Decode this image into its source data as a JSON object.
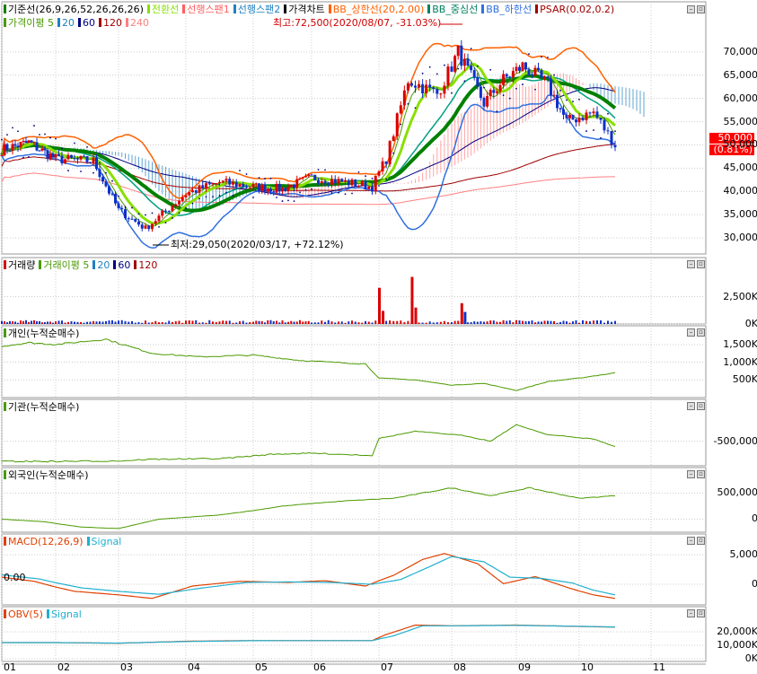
{
  "colors": {
    "bg": "#ffffff",
    "grid": "#cccccc",
    "up": "#d90000",
    "down": "#1030c8",
    "kijun": "#008000",
    "tenkan": "#88e000",
    "span1": "#ff8080",
    "span2": "#2080c0",
    "bb_upper": "#ff6000",
    "bb_mid": "#00a080",
    "bb_lower": "#3070e0",
    "ma20": "#2080c0",
    "ma60": "#000080",
    "ma120": "#a00000",
    "ma240": "#ff8080",
    "flow": "#4a9a00",
    "macd": "#e04000",
    "signal": "#20b0d0",
    "obv": "#e04000"
  },
  "legend_price_1": [
    {
      "text": "기준선(26,9,26,52,26,26,26)",
      "color": "#000000",
      "marker": "#008000"
    },
    {
      "text": "전환선",
      "color": "#88e000",
      "marker": "#88e000"
    },
    {
      "text": "선행스팬1",
      "color": "#ff6060",
      "marker": "#ff6060"
    },
    {
      "text": "선행스팬2",
      "color": "#2080c0",
      "marker": "#2080c0"
    },
    {
      "text": "가격차트",
      "color": "#000000",
      "marker": "#000000"
    },
    {
      "text": "BB_상한선(20,2.00)",
      "color": "#ff6000",
      "marker": "#ff6000"
    },
    {
      "text": "BB_중심선",
      "color": "#008060",
      "marker": "#008060"
    },
    {
      "text": "BB_하한선",
      "color": "#3070e0",
      "marker": "#3070e0"
    },
    {
      "text": "PSAR(0.02,0.2)",
      "color": "#a00000",
      "marker": "#a00000"
    }
  ],
  "legend_price_2": [
    {
      "text": "가격이평 5",
      "color": "#4a9a00",
      "marker": "#4a9a00"
    },
    {
      "text": "20",
      "color": "#2080c0",
      "marker": "#2080c0"
    },
    {
      "text": "60",
      "color": "#000080",
      "marker": "#000080"
    },
    {
      "text": "120",
      "color": "#a00000",
      "marker": "#a00000"
    },
    {
      "text": "240",
      "color": "#ff8080",
      "marker": "#ff8080"
    }
  ],
  "annotations": {
    "high": "최고:72,500(2020/08/07, -31.03%)",
    "low": "최저:29,050(2020/03/17, +72.12%)",
    "current_price": "50,000",
    "current_change": "(0.81%)"
  },
  "x_axis": {
    "labels": [
      "01",
      "02",
      "03",
      "04",
      "05",
      "06",
      "07",
      "08",
      "09",
      "10",
      "11"
    ]
  },
  "panels": {
    "volume": {
      "legend": [
        {
          "text": "거래량",
          "color": "#000000",
          "marker": "#d90000"
        },
        {
          "text": "거래이평 5",
          "color": "#4a9a00",
          "marker": "#4a9a00"
        },
        {
          "text": "20",
          "color": "#2080c0",
          "marker": "#2080c0"
        },
        {
          "text": "60",
          "color": "#000080",
          "marker": "#000080"
        },
        {
          "text": "120",
          "color": "#a00000",
          "marker": "#a00000"
        }
      ]
    },
    "individual": {
      "legend": [
        {
          "text": "개인(누적순매수)",
          "color": "#000000",
          "marker": "#4a9a00"
        }
      ]
    },
    "institution": {
      "legend": [
        {
          "text": "기관(누적순매수)",
          "color": "#000000",
          "marker": "#4a9a00"
        }
      ]
    },
    "foreign": {
      "legend": [
        {
          "text": "외국인(누적순매수)",
          "color": "#000000",
          "marker": "#4a9a00"
        }
      ]
    },
    "macd": {
      "legend": [
        {
          "text": "MACD(12,26,9)",
          "color": "#e04000",
          "marker": "#e04000"
        },
        {
          "text": "Signal",
          "color": "#20b0d0",
          "marker": "#20b0d0"
        }
      ],
      "zero_label": "0.00"
    },
    "obv": {
      "legend": [
        {
          "text": "OBV(5)",
          "color": "#e04000",
          "marker": "#e04000"
        },
        {
          "text": "Signal",
          "color": "#20b0d0",
          "marker": "#20b0d0"
        }
      ]
    }
  },
  "chart_data": [
    {
      "type": "candlestick",
      "title": "가격차트",
      "months": [
        "01",
        "02",
        "03",
        "04",
        "05",
        "06",
        "07",
        "08",
        "09",
        "10"
      ],
      "close_trend": [
        {
          "m": 1.0,
          "v": 49000
        },
        {
          "m": 1.5,
          "v": 50500
        },
        {
          "m": 2.0,
          "v": 47000
        },
        {
          "m": 2.6,
          "v": 46500
        },
        {
          "m": 3.0,
          "v": 36000
        },
        {
          "m": 3.4,
          "v": 32000
        },
        {
          "m": 3.6,
          "v": 34500
        },
        {
          "m": 4.0,
          "v": 39500
        },
        {
          "m": 4.5,
          "v": 42000
        },
        {
          "m": 5.0,
          "v": 41000
        },
        {
          "m": 5.5,
          "v": 40500
        },
        {
          "m": 6.0,
          "v": 43000
        },
        {
          "m": 6.5,
          "v": 42000
        },
        {
          "m": 6.9,
          "v": 41000
        },
        {
          "m": 7.1,
          "v": 47000
        },
        {
          "m": 7.4,
          "v": 64000
        },
        {
          "m": 7.8,
          "v": 61000
        },
        {
          "m": 8.1,
          "v": 70000
        },
        {
          "m": 8.5,
          "v": 59000
        },
        {
          "m": 8.8,
          "v": 64000
        },
        {
          "m": 9.1,
          "v": 67000
        },
        {
          "m": 9.5,
          "v": 63000
        },
        {
          "m": 9.8,
          "v": 55000
        },
        {
          "m": 10.2,
          "v": 57000
        },
        {
          "m": 10.5,
          "v": 50000
        }
      ],
      "high": 72500,
      "low": 29050,
      "last": 50000,
      "ylim": [
        27500,
        75000
      ],
      "yticks": [
        30000,
        35000,
        40000,
        45000,
        50000,
        55000,
        60000,
        65000,
        70000
      ],
      "ytick_labels": [
        "30,000",
        "35,000",
        "40,000",
        "45,000",
        "50,000",
        "55,000",
        "60,000",
        "65,000",
        "70,000"
      ]
    },
    {
      "type": "bar",
      "title": "거래량",
      "yticks": [
        0,
        2500000
      ],
      "ytick_labels": [
        "0K",
        "2,500K"
      ],
      "ylim": [
        0,
        5000000
      ],
      "baseline": 250000,
      "spikes": [
        {
          "m": 7.0,
          "v": 3300000,
          "dir": "up"
        },
        {
          "m": 7.05,
          "v": 1200000,
          "dir": "up"
        },
        {
          "m": 7.45,
          "v": 4300000,
          "dir": "up"
        },
        {
          "m": 7.5,
          "v": 1500000,
          "dir": "up"
        },
        {
          "m": 8.15,
          "v": 1900000,
          "dir": "up"
        },
        {
          "m": 8.2,
          "v": 1100000,
          "dir": "down"
        }
      ]
    },
    {
      "type": "line",
      "title": "개인(누적순매수)",
      "yticks": [
        500000,
        1000000,
        1500000
      ],
      "ytick_labels": [
        "500K",
        "1,000K",
        "1,500K"
      ],
      "ylim": [
        0,
        1800000
      ],
      "points": [
        {
          "m": 1.0,
          "v": 1450000
        },
        {
          "m": 1.5,
          "v": 1550000
        },
        {
          "m": 2.0,
          "v": 1500000
        },
        {
          "m": 2.8,
          "v": 1650000
        },
        {
          "m": 3.5,
          "v": 1250000
        },
        {
          "m": 4.2,
          "v": 1150000
        },
        {
          "m": 5.0,
          "v": 1200000
        },
        {
          "m": 5.8,
          "v": 1050000
        },
        {
          "m": 6.8,
          "v": 950000
        },
        {
          "m": 7.0,
          "v": 550000
        },
        {
          "m": 7.5,
          "v": 500000
        },
        {
          "m": 8.0,
          "v": 350000
        },
        {
          "m": 8.5,
          "v": 400000
        },
        {
          "m": 9.0,
          "v": 200000
        },
        {
          "m": 9.5,
          "v": 450000
        },
        {
          "m": 10.0,
          "v": 550000
        },
        {
          "m": 10.5,
          "v": 700000
        }
      ]
    },
    {
      "type": "line",
      "title": "기관(누적순매수)",
      "yticks": [
        -500000
      ],
      "ytick_labels": [
        "-500,000"
      ],
      "ylim": [
        -950000,
        100000
      ],
      "points": [
        {
          "m": 1.0,
          "v": -870000
        },
        {
          "m": 2.0,
          "v": -870000
        },
        {
          "m": 3.0,
          "v": -860000
        },
        {
          "m": 3.5,
          "v": -830000
        },
        {
          "m": 4.5,
          "v": -820000
        },
        {
          "m": 5.3,
          "v": -740000
        },
        {
          "m": 6.0,
          "v": -720000
        },
        {
          "m": 6.9,
          "v": -760000
        },
        {
          "m": 7.0,
          "v": -450000
        },
        {
          "m": 7.5,
          "v": -320000
        },
        {
          "m": 8.2,
          "v": -400000
        },
        {
          "m": 8.6,
          "v": -500000
        },
        {
          "m": 9.0,
          "v": -200000
        },
        {
          "m": 9.5,
          "v": -380000
        },
        {
          "m": 10.2,
          "v": -460000
        },
        {
          "m": 10.5,
          "v": -600000
        }
      ]
    },
    {
      "type": "line",
      "title": "외국인(누적순매수)",
      "yticks": [
        0,
        500000
      ],
      "ytick_labels": [
        "0",
        "500,000"
      ],
      "ylim": [
        -250000,
        800000
      ],
      "points": [
        {
          "m": 1.0,
          "v": 0
        },
        {
          "m": 1.8,
          "v": -50000
        },
        {
          "m": 2.4,
          "v": -150000
        },
        {
          "m": 3.0,
          "v": -180000
        },
        {
          "m": 3.6,
          "v": 0
        },
        {
          "m": 4.5,
          "v": 80000
        },
        {
          "m": 5.5,
          "v": 250000
        },
        {
          "m": 6.5,
          "v": 350000
        },
        {
          "m": 7.2,
          "v": 400000
        },
        {
          "m": 8.0,
          "v": 600000
        },
        {
          "m": 8.6,
          "v": 450000
        },
        {
          "m": 9.2,
          "v": 600000
        },
        {
          "m": 10.0,
          "v": 400000
        },
        {
          "m": 10.5,
          "v": 450000
        }
      ]
    },
    {
      "type": "line",
      "title": "MACD(12,26,9)",
      "yticks": [
        0,
        5000
      ],
      "ytick_labels": [
        "0",
        "5,000"
      ],
      "ylim": [
        -3500,
        7000
      ],
      "series": [
        {
          "name": "MACD(12,26,9)",
          "points": [
            {
              "m": 1.0,
              "v": 1200
            },
            {
              "m": 1.6,
              "v": 500
            },
            {
              "m": 2.3,
              "v": -1200
            },
            {
              "m": 3.0,
              "v": -1800
            },
            {
              "m": 3.5,
              "v": -2400
            },
            {
              "m": 4.1,
              "v": -300
            },
            {
              "m": 4.8,
              "v": 500
            },
            {
              "m": 5.6,
              "v": 300
            },
            {
              "m": 6.2,
              "v": 600
            },
            {
              "m": 6.8,
              "v": -300
            },
            {
              "m": 7.2,
              "v": 1500
            },
            {
              "m": 7.6,
              "v": 4200
            },
            {
              "m": 7.9,
              "v": 5200
            },
            {
              "m": 8.4,
              "v": 3500
            },
            {
              "m": 8.8,
              "v": 100
            },
            {
              "m": 9.3,
              "v": 1300
            },
            {
              "m": 9.8,
              "v": -500
            },
            {
              "m": 10.2,
              "v": -1800
            },
            {
              "m": 10.5,
              "v": -2400
            }
          ]
        },
        {
          "name": "Signal",
          "points": [
            {
              "m": 1.0,
              "v": 1600
            },
            {
              "m": 1.7,
              "v": 900
            },
            {
              "m": 2.4,
              "v": -600
            },
            {
              "m": 3.0,
              "v": -1200
            },
            {
              "m": 3.6,
              "v": -1700
            },
            {
              "m": 4.2,
              "v": -700
            },
            {
              "m": 4.9,
              "v": 300
            },
            {
              "m": 5.6,
              "v": 400
            },
            {
              "m": 6.3,
              "v": 300
            },
            {
              "m": 6.9,
              "v": 0
            },
            {
              "m": 7.3,
              "v": 800
            },
            {
              "m": 7.7,
              "v": 3000
            },
            {
              "m": 8.0,
              "v": 4700
            },
            {
              "m": 8.5,
              "v": 3800
            },
            {
              "m": 8.9,
              "v": 1200
            },
            {
              "m": 9.4,
              "v": 1000
            },
            {
              "m": 9.9,
              "v": 200
            },
            {
              "m": 10.2,
              "v": -1000
            },
            {
              "m": 10.5,
              "v": -1800
            }
          ]
        }
      ]
    },
    {
      "type": "line",
      "title": "OBV(5)",
      "yticks": [
        0,
        10000000,
        20000000
      ],
      "ytick_labels": [
        "0K",
        "10,000K",
        "20,000K"
      ],
      "ylim": [
        -2000000,
        32000000
      ],
      "series": [
        {
          "name": "OBV(5)",
          "points": [
            {
              "m": 1.0,
              "v": 12000000
            },
            {
              "m": 2.0,
              "v": 12000000
            },
            {
              "m": 3.0,
              "v": 11500000
            },
            {
              "m": 4.0,
              "v": 13000000
            },
            {
              "m": 5.0,
              "v": 13500000
            },
            {
              "m": 6.0,
              "v": 13500000
            },
            {
              "m": 6.9,
              "v": 13500000
            },
            {
              "m": 7.1,
              "v": 18000000
            },
            {
              "m": 7.5,
              "v": 25000000
            },
            {
              "m": 8.0,
              "v": 24500000
            },
            {
              "m": 9.0,
              "v": 25000000
            },
            {
              "m": 10.0,
              "v": 24000000
            },
            {
              "m": 10.5,
              "v": 23500000
            }
          ]
        },
        {
          "name": "Signal",
          "points": [
            {
              "m": 1.0,
              "v": 12000000
            },
            {
              "m": 2.0,
              "v": 12000000
            },
            {
              "m": 3.0,
              "v": 11600000
            },
            {
              "m": 4.0,
              "v": 12800000
            },
            {
              "m": 5.0,
              "v": 13400000
            },
            {
              "m": 6.0,
              "v": 13500000
            },
            {
              "m": 6.9,
              "v": 13500000
            },
            {
              "m": 7.2,
              "v": 17000000
            },
            {
              "m": 7.6,
              "v": 24500000
            },
            {
              "m": 8.0,
              "v": 24500000
            },
            {
              "m": 9.0,
              "v": 24800000
            },
            {
              "m": 10.0,
              "v": 24100000
            },
            {
              "m": 10.5,
              "v": 23600000
            }
          ]
        }
      ]
    }
  ]
}
